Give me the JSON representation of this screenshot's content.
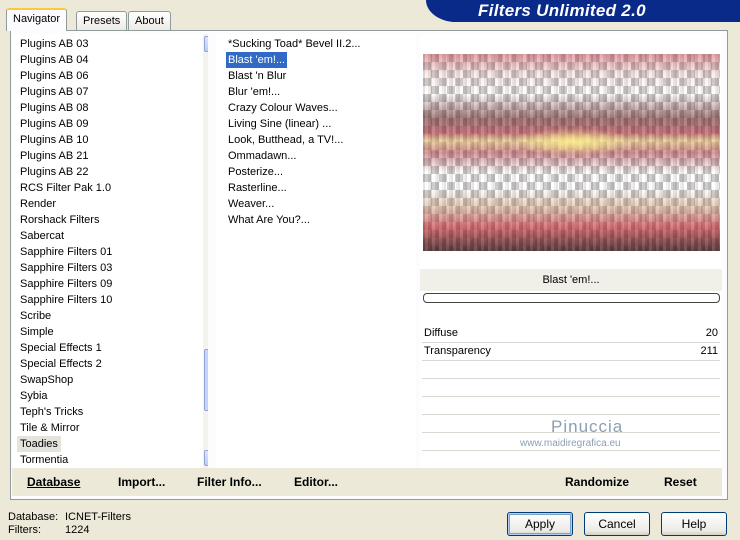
{
  "tabs": [
    {
      "label": "Navigator"
    },
    {
      "label": "Presets"
    },
    {
      "label": "About"
    }
  ],
  "banner": {
    "title": "Filters Unlimited 2.0"
  },
  "categories": [
    "Plugins AB 03",
    "Plugins AB 04",
    "Plugins AB 06",
    "Plugins AB 07",
    "Plugins AB 08",
    "Plugins AB 09",
    "Plugins AB 10",
    "Plugins AB 21",
    "Plugins AB 22",
    "RCS Filter Pak 1.0",
    "Render",
    "Rorshack Filters",
    "Sabercat",
    "Sapphire Filters 01",
    "Sapphire Filters 03",
    "Sapphire Filters 09",
    "Sapphire Filters 10",
    "Scribe",
    "Simple",
    "Special Effects 1",
    "Special Effects 2",
    "SwapShop",
    "Sybia",
    "Teph's Tricks",
    "Tile & Mirror",
    "Toadies",
    "Tormentia"
  ],
  "selected_category": "Toadies",
  "filters": [
    "*Sucking Toad*  Bevel II.2...",
    "Blast 'em!...",
    "Blast 'n Blur",
    "Blur 'em!...",
    "Crazy Colour Waves...",
    "Living Sine (linear) ...",
    "Look, Butthead, a TV!...",
    "Ommadawn...",
    "Posterize...",
    "Rasterline...",
    "Weaver...",
    "What Are You?..."
  ],
  "selected_filter": "Blast 'em!...",
  "preview": {
    "filter_name": "Blast 'em!...",
    "progress": 0
  },
  "params": [
    {
      "label": "Diffuse",
      "value": "20"
    },
    {
      "label": "Transparency",
      "value": "211"
    }
  ],
  "watermark": {
    "name": "Pinuccia",
    "site": "www.maidiregrafica.eu"
  },
  "toolbar": {
    "database": "Database",
    "import": "Import...",
    "filter_info": "Filter Info...",
    "editor": "Editor...",
    "randomize": "Randomize",
    "reset": "Reset"
  },
  "footer": {
    "database_label": "Database:",
    "database_value": "ICNET-Filters",
    "filters_label": "Filters:",
    "filters_value": "1224"
  },
  "buttons": {
    "apply": "Apply",
    "cancel": "Cancel",
    "help": "Help"
  },
  "icons": {
    "scroll_up": "scroll-up-arrow-icon",
    "scroll_down": "scroll-down-arrow-icon"
  },
  "colors": {
    "selection": "#316ac5",
    "banner": "#0a2a8a",
    "default_button_border": "#003c74"
  }
}
